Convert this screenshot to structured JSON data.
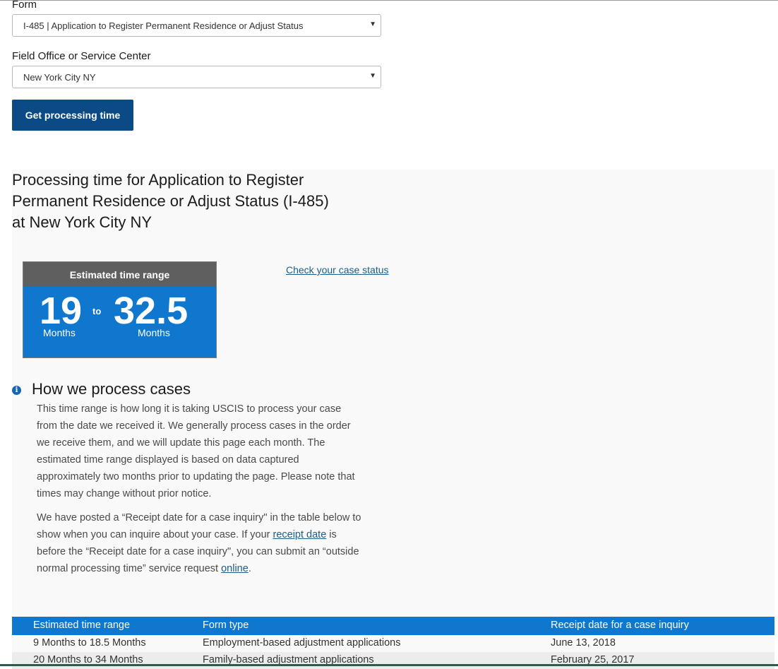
{
  "form": {
    "label": "Form",
    "selected": "I-485 | Application to Register Permanent Residence or Adjust Status"
  },
  "office": {
    "label": "Field Office or Service Center",
    "selected": "New York City NY"
  },
  "button_label": "Get processing time",
  "result_title": "Processing time for Application to Register Permanent Residence or Adjust Status (I-485) at New York City NY",
  "range": {
    "header": "Estimated time range",
    "min_value": "19",
    "min_unit": "Months",
    "to": "to",
    "max_value": "32.5",
    "max_unit": "Months"
  },
  "check_status_link": "Check your case status",
  "how": {
    "title": "How we process cases",
    "p1": "This time range is how long it is taking USCIS to process your case from the date we received it. We generally process cases in the order we receive them, and we will update this page each month. The estimated time range displayed is based on data captured approximately two months prior to updating the page. Please note that times may change without prior notice.",
    "p2_a": "We have posted a “Receipt date for a case inquiry\" in the table below to show when you can inquire about your case. If your ",
    "p2_link1": "receipt date",
    "p2_b": " is before the “Receipt date for a case inquiry\", you can submit an “outside normal processing time” service request ",
    "p2_link2": "online",
    "p2_c": "."
  },
  "table": {
    "headers": [
      "Estimated time range",
      "Form type",
      "Receipt date for a case inquiry"
    ],
    "rows": [
      [
        "9 Months to 18.5 Months",
        "Employment-based adjustment applications",
        "June 13, 2018"
      ],
      [
        "20 Months to 34 Months",
        "Family-based adjustment applications",
        "February 25, 2017"
      ]
    ]
  },
  "colors": {
    "button": "#0b4a85",
    "range_blue": "#0f77cd",
    "range_header": "#5f5f5f",
    "link": "#1a5d8c"
  },
  "icons": [
    "chevron-down-icon",
    "info-icon"
  ]
}
